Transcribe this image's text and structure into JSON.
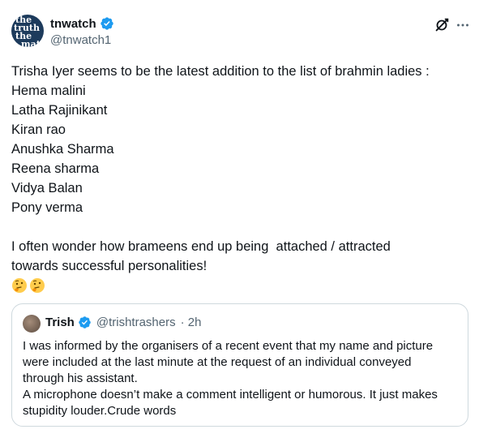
{
  "tweet": {
    "avatar_text": [
      "the",
      "truth",
      "the",
      "mat"
    ],
    "display_name": "tnwatch",
    "handle": "@tnwatch1",
    "body_lines": [
      "Trisha Iyer seems to be the latest addition to the list of brahmin ladies :",
      "Hema malini",
      "Latha Rajinikant",
      "Kiran rao",
      "Anushka Sharma",
      "Reena sharma",
      "Vidya Balan",
      "Pony verma",
      "",
      "I often wonder how brameens end up being  attached / attracted",
      "towards successful personalities!"
    ],
    "emojis": [
      "thinking-face",
      "thinking-face"
    ]
  },
  "quoted": {
    "display_name": "Trish",
    "handle": "@trishtrashers",
    "time": "· 2h",
    "body_lines": [
      "I was informed by the organisers of a recent event that my name and picture",
      "were included at the last minute at the request of an individual conveyed",
      "through his assistant.",
      "A microphone doesn’t make a comment intelligent or humorous. It just makes",
      "stupidity louder.Crude words"
    ]
  },
  "colors": {
    "text": "#0f1419",
    "secondary": "#536471",
    "verified": "#1d9bf0",
    "border": "#cfd9de"
  },
  "icons": {
    "verified": "verified-badge-icon",
    "grok": "grok-icon",
    "more": "more-icon",
    "emoji": "thinking-face-icon"
  }
}
